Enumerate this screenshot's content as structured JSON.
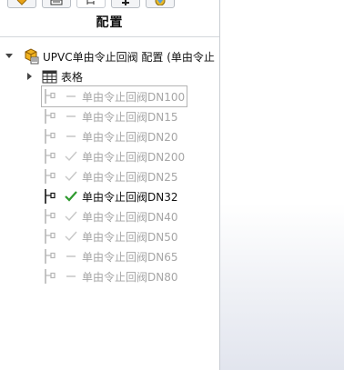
{
  "panel": {
    "title": "配置",
    "tabs": [
      {
        "icon": "feature-tree-icon"
      },
      {
        "icon": "property-manager-icon"
      },
      {
        "icon": "configuration-manager-icon",
        "active": true
      },
      {
        "icon": "dimxpert-icon"
      },
      {
        "icon": "display-manager-icon"
      }
    ]
  },
  "tree": {
    "root": {
      "label": "UPVC单由令止回阀 配置  (单由令止"
    },
    "table": {
      "label": "表格"
    },
    "configurations": [
      {
        "name": "单由令止回阀DN100",
        "status": "dash",
        "active": false,
        "selected": true
      },
      {
        "name": "单由令止回阀DN15",
        "status": "dash",
        "active": false,
        "selected": false
      },
      {
        "name": "单由令止回阀DN20",
        "status": "dash",
        "active": false,
        "selected": false
      },
      {
        "name": "单由令止回阀DN200",
        "status": "check",
        "active": false,
        "selected": false
      },
      {
        "name": "单由令止回阀DN25",
        "status": "check",
        "active": false,
        "selected": false
      },
      {
        "name": "单由令止回阀DN32",
        "status": "check",
        "active": true,
        "selected": false
      },
      {
        "name": "单由令止回阀DN40",
        "status": "check",
        "active": false,
        "selected": false
      },
      {
        "name": "单由令止回阀DN50",
        "status": "check",
        "active": false,
        "selected": false
      },
      {
        "name": "单由令止回阀DN65",
        "status": "dash",
        "active": false,
        "selected": false
      },
      {
        "name": "单由令止回阀DN80",
        "status": "dash",
        "active": false,
        "selected": false
      }
    ]
  },
  "colors": {
    "active_check": "#2e9a2e",
    "inactive_text": "#a6a6a6",
    "active_text": "#111111",
    "part_icon": "#e8a317"
  }
}
